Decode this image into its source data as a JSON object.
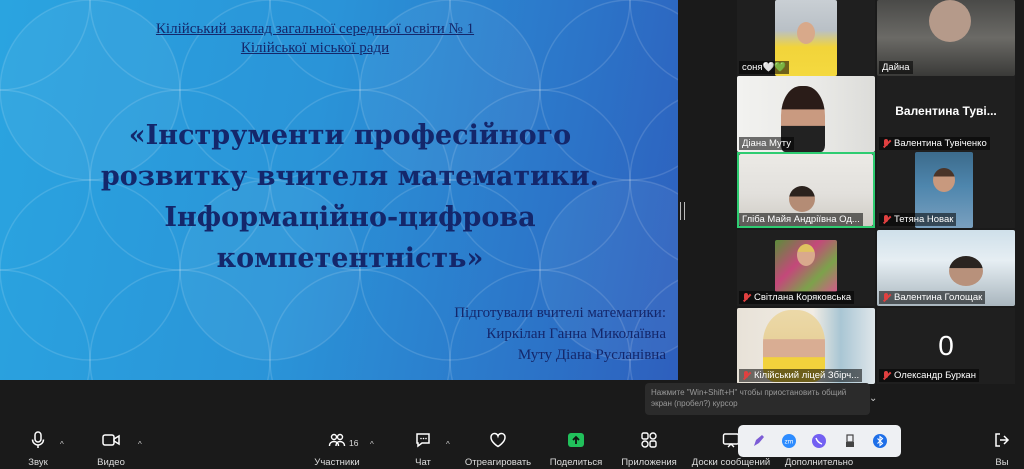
{
  "slide": {
    "institution_line1": "Кілійський заклад загальної середньої освіти № 1",
    "institution_line2": "Кілійської міської ради",
    "title_line1": "«Інструменти професійного",
    "title_line2": "розвитку вчителя математики.",
    "title_line3": "Інформаційно-цифрова",
    "title_line4": "компетентність»",
    "authors_intro": "Підготували вчителі математики:",
    "author1": "Киркілан Ганна Миколаївна",
    "author2": "Муту Діана Русланівна"
  },
  "participants": [
    {
      "name": "соня🤍💚",
      "muted": false,
      "video": true
    },
    {
      "name": "Дайна",
      "muted": false,
      "video": true
    },
    {
      "name": "Діана Муту",
      "muted": false,
      "video": true
    },
    {
      "name": "Валентина Тувіченко",
      "display": "Валентина Туві...",
      "muted": true,
      "video": false
    },
    {
      "name": "Гліба  Майя Андріївна Од...",
      "muted": false,
      "video": true,
      "active": true
    },
    {
      "name": "Тетяна Новак",
      "muted": true,
      "video": true
    },
    {
      "name": "Світлана Коряковська",
      "muted": true,
      "video": true
    },
    {
      "name": "Валентина Голощак",
      "muted": true,
      "video": true
    },
    {
      "name": "Кілійський ліцей Збірч...",
      "muted": true,
      "video": true
    },
    {
      "name": "Олександр Буркан",
      "display": "0",
      "muted": true,
      "video": false
    }
  ],
  "share_tooltip": "Нажмите \"Win+Shift+H\" чтобы приостановить общий экран (пробел?) курсор",
  "toolbar": {
    "audio": "Звук",
    "video": "Видео",
    "participants": "Участники",
    "participants_count": "16",
    "chat": "Чат",
    "react": "Отреагировать",
    "share": "Поделиться",
    "apps": "Приложения",
    "whiteboards": "Доски сообщений",
    "more": "Дополнительно",
    "leave": "Вы"
  },
  "apps": [
    "pen-icon",
    "zoom-app-icon",
    "viber-icon",
    "usb-icon",
    "bluetooth-icon"
  ],
  "colors": {
    "slide_text": "#14276b",
    "active_speaker": "#2ecc71",
    "share_green": "#21c05b",
    "muted_red": "#e04040"
  }
}
